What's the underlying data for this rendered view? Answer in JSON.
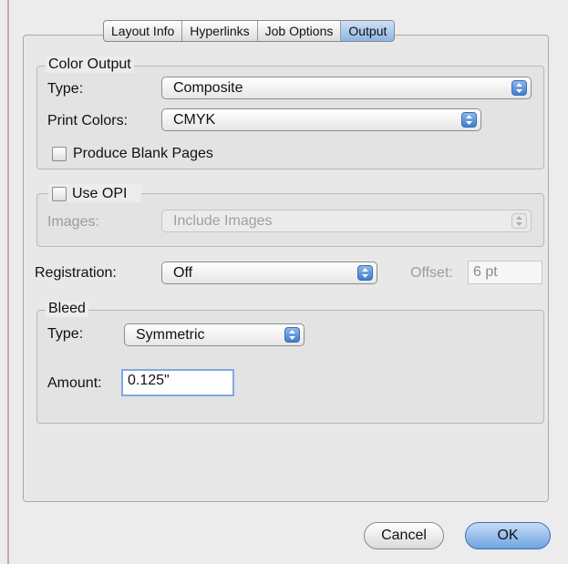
{
  "tabs": [
    "Layout Info",
    "Hyperlinks",
    "Job Options",
    "Output"
  ],
  "active_tab": "Output",
  "color_output": {
    "legend": "Color Output",
    "type_label": "Type:",
    "type_value": "Composite",
    "print_colors_label": "Print Colors:",
    "print_colors_value": "CMYK",
    "blank_pages_label": "Produce Blank Pages",
    "blank_pages_checked": false
  },
  "opi": {
    "legend": "Use OPI",
    "checked": false,
    "images_label": "Images:",
    "images_value": "Include Images"
  },
  "registration": {
    "label": "Registration:",
    "value": "Off",
    "offset_label": "Offset:",
    "offset_value": "6 pt"
  },
  "bleed": {
    "legend": "Bleed",
    "type_label": "Type:",
    "type_value": "Symmetric",
    "amount_label": "Amount:",
    "amount_value": "0.125\""
  },
  "buttons": {
    "cancel": "Cancel",
    "ok": "OK"
  },
  "colors": {
    "accent": "#5b97dc",
    "panel": "#e8e8e8"
  },
  "icons": {
    "popup_arrows": "up-down-arrows-icon"
  }
}
